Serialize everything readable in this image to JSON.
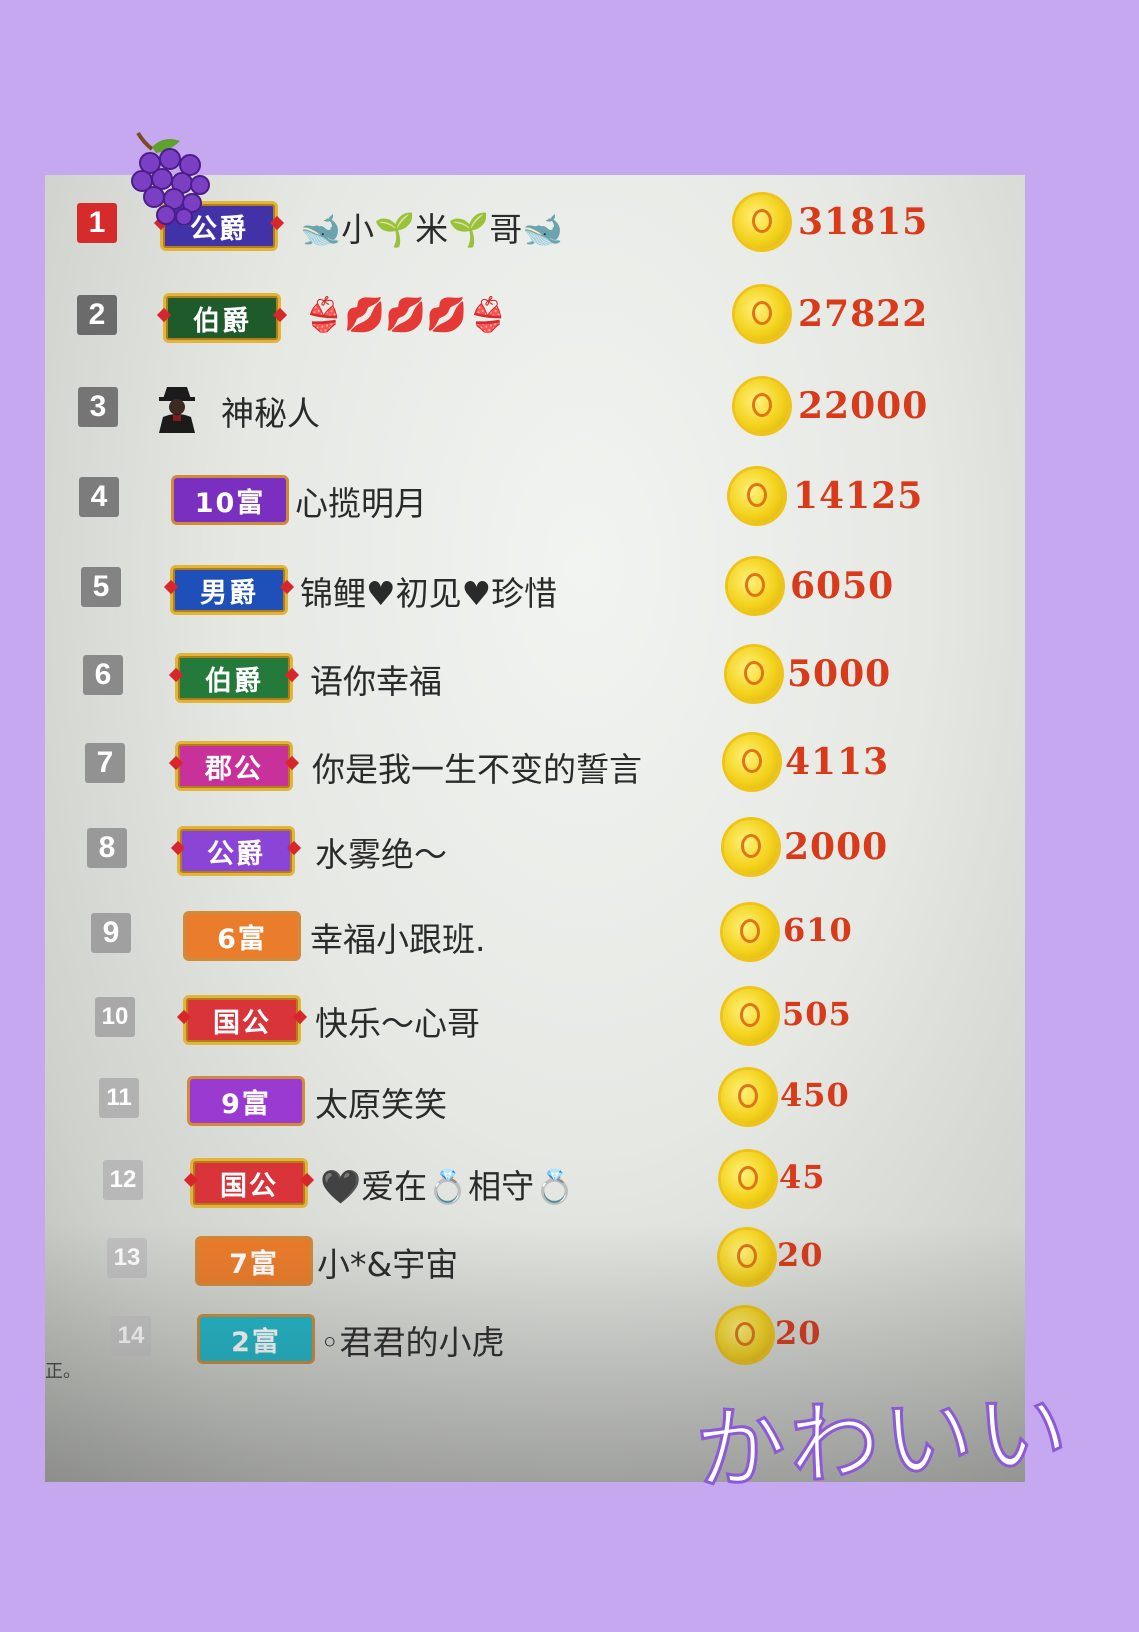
{
  "leaderboard": [
    {
      "rank": "1",
      "badge": "公爵",
      "name": "🐋小🌱米🌱哥🐋",
      "amount": "31815",
      "badge_color": "#4232a8",
      "rank_color": "#d62b2b"
    },
    {
      "rank": "2",
      "badge": "伯爵",
      "name": "👙💋💋💋👙",
      "amount": "27822",
      "badge_color": "#1e5a2a",
      "rank_color": "#6b6b6b"
    },
    {
      "rank": "3",
      "badge": "",
      "name": "神秘人",
      "amount": "22000",
      "badge_color": "",
      "rank_color": "#757575"
    },
    {
      "rank": "4",
      "badge": "10富",
      "name": "心揽明月",
      "amount": "14125",
      "badge_color": "#7a2fc0",
      "rank_color": "#7c7c7c"
    },
    {
      "rank": "5",
      "badge": "男爵",
      "name": "锦鲤♥初见♥珍惜",
      "amount": "6050",
      "badge_color": "#1f4fb8",
      "rank_color": "#838383"
    },
    {
      "rank": "6",
      "badge": "伯爵",
      "name": "语你幸福",
      "amount": "5000",
      "badge_color": "#237a3a",
      "rank_color": "#8a8a8a"
    },
    {
      "rank": "7",
      "badge": "郡公",
      "name": "你是我一生不变的誓言",
      "amount": "4113",
      "badge_color": "#c8309a",
      "rank_color": "#929292"
    },
    {
      "rank": "8",
      "badge": "公爵",
      "name": "水雾绝～",
      "amount": "2000",
      "badge_color": "#8a45d6",
      "rank_color": "#999999"
    },
    {
      "rank": "9",
      "badge": "6富",
      "name": "幸福小跟班.",
      "amount": "610",
      "badge_color": "#ea7d2b",
      "rank_color": "#a0a0a0"
    },
    {
      "rank": "10",
      "badge": "国公",
      "name": "快乐～心哥",
      "amount": "505",
      "badge_color": "#d8343a",
      "rank_color": "#a9a9a9"
    },
    {
      "rank": "11",
      "badge": "9富",
      "name": "太原笑笑",
      "amount": "450",
      "badge_color": "#9a3ad0",
      "rank_color": "#b2b2b2"
    },
    {
      "rank": "12",
      "badge": "国公",
      "name": "🖤爱在💍相守💍",
      "amount": "45",
      "badge_color": "#d8343a",
      "rank_color": "#b8b8b8"
    },
    {
      "rank": "13",
      "badge": "7富",
      "name": "小*&宇宙",
      "amount": "20",
      "badge_color": "#ec7c2a",
      "rank_color": "#c0c0c0"
    },
    {
      "rank": "14",
      "badge": "2富",
      "name": "◦君君的小虎",
      "amount": "20",
      "badge_color": "#1fb7c9",
      "rank_color": "#c6c6c6"
    }
  ],
  "cut_text": "正。",
  "sticker_text": "かわいい",
  "colors": {
    "background": "#c6a8f0",
    "amount": "#d83a1a",
    "coin": "#f3d21c"
  }
}
